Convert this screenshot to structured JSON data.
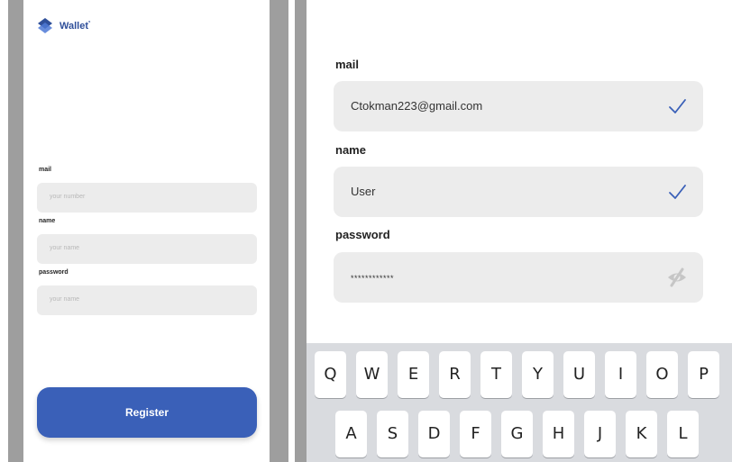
{
  "left_screen": {
    "brand": {
      "name": "Wallet",
      "mark": "°"
    },
    "fields": [
      {
        "label": "mail",
        "placeholder": "your number"
      },
      {
        "label": "name",
        "placeholder": "your name"
      },
      {
        "label": "password",
        "placeholder": "your name"
      }
    ],
    "register_label": "Register"
  },
  "right_screen": {
    "fields": [
      {
        "label": "mail",
        "value": "Ctokman223@gmail.com",
        "icon": "checkmark-icon"
      },
      {
        "label": "name",
        "value": "User",
        "icon": "checkmark-icon"
      },
      {
        "label": "password",
        "value": "************",
        "icon": "eye-off-icon"
      }
    ],
    "keyboard": {
      "row1": [
        "Q",
        "W",
        "E",
        "R",
        "T",
        "Y",
        "U",
        "I",
        "O",
        "P"
      ],
      "row2": [
        "A",
        "S",
        "D",
        "F",
        "G",
        "H",
        "J",
        "K",
        "L"
      ]
    }
  },
  "colors": {
    "accent": "#3a60b8",
    "field_bg": "#ececec",
    "frame": "#9e9e9e",
    "keyboard_bg": "#d9dbdf"
  }
}
